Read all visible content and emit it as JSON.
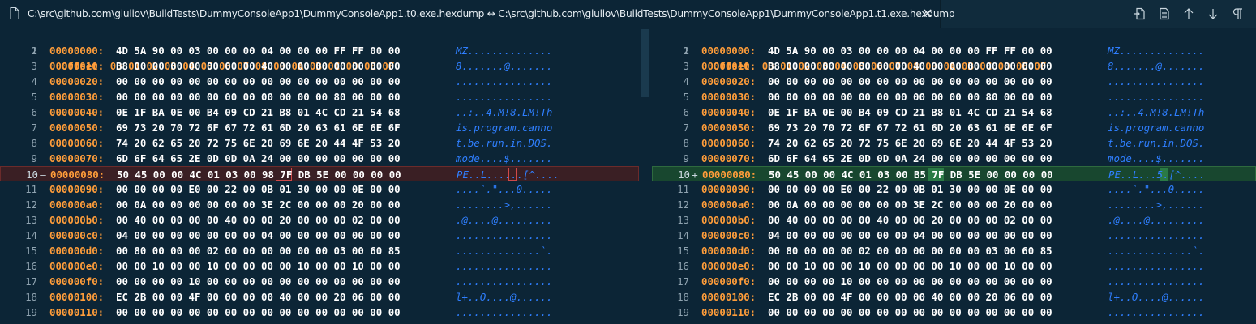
{
  "tab": {
    "title": "C:\\src\\github.com\\giuliov\\BuildTests\\DummyConsoleApp1\\DummyConsoleApp1.t0.exe.hexdump ↔ C:\\src\\github.com\\giuliov\\BuildTests\\DummyConsoleApp1\\DummyConsoleApp1.t1.exe.hexdump",
    "close_glyph": "✕",
    "icon": "file-icon"
  },
  "actions": [
    "open-file-icon",
    "open-preview-icon",
    "arrow-up-icon",
    "arrow-down-icon",
    "pilcrow-icon"
  ],
  "colors": {
    "background": "#0c2536",
    "offset": "#ff9d3a",
    "hex": "#ffffff",
    "ascii": "#2f7fff",
    "removed_line": "#3a1f24",
    "inserted_line": "#18472f"
  },
  "header": {
    "ln": "1",
    "label": "Offset:",
    "cols": "00 01 02 03 04 05 06 07 08 09 0A 0B 0C 0D 0E 0F"
  },
  "left": {
    "rows": [
      {
        "ln": "2",
        "off": "00000000:",
        "hex": "4D 5A 90 00 03 00 00 00 04 00 00 00 FF FF 00 00",
        "asc": "MZ.............."
      },
      {
        "ln": "3",
        "off": "00000010:",
        "hex": "B8 00 00 00 00 00 00 00 40 00 00 00 00 00 00 00",
        "asc": "8.......@......."
      },
      {
        "ln": "4",
        "off": "00000020:",
        "hex": "00 00 00 00 00 00 00 00 00 00 00 00 00 00 00 00",
        "asc": "................"
      },
      {
        "ln": "5",
        "off": "00000030:",
        "hex": "00 00 00 00 00 00 00 00 00 00 00 00 80 00 00 00",
        "asc": "................"
      },
      {
        "ln": "6",
        "off": "00000040:",
        "hex": "0E 1F BA 0E 00 B4 09 CD 21 B8 01 4C CD 21 54 68",
        "asc": "..:..4.M!8.LM!Th"
      },
      {
        "ln": "7",
        "off": "00000050:",
        "hex": "69 73 20 70 72 6F 67 72 61 6D 20 63 61 6E 6E 6F",
        "asc": "is.program.canno"
      },
      {
        "ln": "8",
        "off": "00000060:",
        "hex": "74 20 62 65 20 72 75 6E 20 69 6E 20 44 4F 53 20",
        "asc": "t.be.run.in.DOS."
      },
      {
        "ln": "9",
        "off": "00000070:",
        "hex": "6D 6F 64 65 2E 0D 0D 0A 24 00 00 00 00 00 00 00",
        "asc": "mode....$......."
      },
      {
        "ln": "10",
        "mark": "—",
        "off": "00000080:",
        "hex": "50 45 00 00 4C 01 03 00 98 7F DB 5E 00 00 00 00",
        "asc": "PE..L......[^....",
        "state": "removed"
      },
      {
        "ln": "11",
        "off": "00000090:",
        "hex": "00 00 00 00 E0 00 22 00 0B 01 30 00 00 0E 00 00",
        "asc": "....`.\"...0....."
      },
      {
        "ln": "12",
        "off": "000000a0:",
        "hex": "00 0A 00 00 00 00 00 00 3E 2C 00 00 00 20 00 00",
        "asc": "........>,......"
      },
      {
        "ln": "13",
        "off": "000000b0:",
        "hex": "00 40 00 00 00 00 40 00 00 20 00 00 00 02 00 00",
        "asc": ".@....@........."
      },
      {
        "ln": "14",
        "off": "000000c0:",
        "hex": "04 00 00 00 00 00 00 00 04 00 00 00 00 00 00 00",
        "asc": "................"
      },
      {
        "ln": "15",
        "off": "000000d0:",
        "hex": "00 80 00 00 00 02 00 00 00 00 00 00 03 00 60 85",
        "asc": "..............`."
      },
      {
        "ln": "16",
        "off": "000000e0:",
        "hex": "00 00 10 00 00 10 00 00 00 00 10 00 00 10 00 00",
        "asc": "................"
      },
      {
        "ln": "17",
        "off": "000000f0:",
        "hex": "00 00 00 00 10 00 00 00 00 00 00 00 00 00 00 00",
        "asc": "................"
      },
      {
        "ln": "18",
        "off": "00000100:",
        "hex": "EC 2B 00 00 4F 00 00 00 00 40 00 00 20 06 00 00",
        "asc": "l+..O....@......"
      },
      {
        "ln": "19",
        "off": "00000110:",
        "hex": "00 00 00 00 00 00 00 00 00 00 00 00 00 00 00 00",
        "asc": "................"
      }
    ]
  },
  "right": {
    "rows": [
      {
        "ln": "2",
        "off": "00000000:",
        "hex": "4D 5A 90 00 03 00 00 00 04 00 00 00 FF FF 00 00",
        "asc": "MZ.............."
      },
      {
        "ln": "3",
        "off": "00000010:",
        "hex": "B8 00 00 00 00 00 00 00 40 00 00 00 00 00 00 00",
        "asc": "8.......@......."
      },
      {
        "ln": "4",
        "off": "00000020:",
        "hex": "00 00 00 00 00 00 00 00 00 00 00 00 00 00 00 00",
        "asc": "................"
      },
      {
        "ln": "5",
        "off": "00000030:",
        "hex": "00 00 00 00 00 00 00 00 00 00 00 00 80 00 00 00",
        "asc": "................"
      },
      {
        "ln": "6",
        "off": "00000040:",
        "hex": "0E 1F BA 0E 00 B4 09 CD 21 B8 01 4C CD 21 54 68",
        "asc": "..:..4.M!8.LM!Th"
      },
      {
        "ln": "7",
        "off": "00000050:",
        "hex": "69 73 20 70 72 6F 67 72 61 6D 20 63 61 6E 6E 6F",
        "asc": "is.program.canno"
      },
      {
        "ln": "8",
        "off": "00000060:",
        "hex": "74 20 62 65 20 72 75 6E 20 69 6E 20 44 4F 53 20",
        "asc": "t.be.run.in.DOS."
      },
      {
        "ln": "9",
        "off": "00000070:",
        "hex": "6D 6F 64 65 2E 0D 0D 0A 24 00 00 00 00 00 00 00",
        "asc": "mode....$......."
      },
      {
        "ln": "10",
        "mark": "+",
        "off": "00000080:",
        "hex": "50 45 00 00 4C 01 03 00 B5 7F DB 5E 00 00 00 00",
        "asc": "PE..L...5.[^....",
        "state": "inserted"
      },
      {
        "ln": "11",
        "off": "00000090:",
        "hex": "00 00 00 00 E0 00 22 00 0B 01 30 00 00 0E 00 00",
        "asc": "....`.\"...0....."
      },
      {
        "ln": "12",
        "off": "000000a0:",
        "hex": "00 0A 00 00 00 00 00 00 3E 2C 00 00 00 20 00 00",
        "asc": "........>,......"
      },
      {
        "ln": "13",
        "off": "000000b0:",
        "hex": "00 40 00 00 00 00 40 00 00 20 00 00 00 02 00 00",
        "asc": ".@....@........."
      },
      {
        "ln": "14",
        "off": "000000c0:",
        "hex": "04 00 00 00 00 00 00 00 04 00 00 00 00 00 00 00",
        "asc": "................"
      },
      {
        "ln": "15",
        "off": "000000d0:",
        "hex": "00 80 00 00 00 02 00 00 00 00 00 00 03 00 60 85",
        "asc": "..............`."
      },
      {
        "ln": "16",
        "off": "000000e0:",
        "hex": "00 00 10 00 00 10 00 00 00 00 10 00 00 10 00 00",
        "asc": "................"
      },
      {
        "ln": "17",
        "off": "000000f0:",
        "hex": "00 00 00 00 10 00 00 00 00 00 00 00 00 00 00 00",
        "asc": "................"
      },
      {
        "ln": "18",
        "off": "00000100:",
        "hex": "EC 2B 00 00 4F 00 00 00 00 40 00 00 20 06 00 00",
        "asc": "l+..O....@......"
      },
      {
        "ln": "19",
        "off": "00000110:",
        "hex": "00 00 00 00 00 00 00 00 00 00 00 00 00 00 00 00",
        "asc": "................"
      }
    ]
  }
}
